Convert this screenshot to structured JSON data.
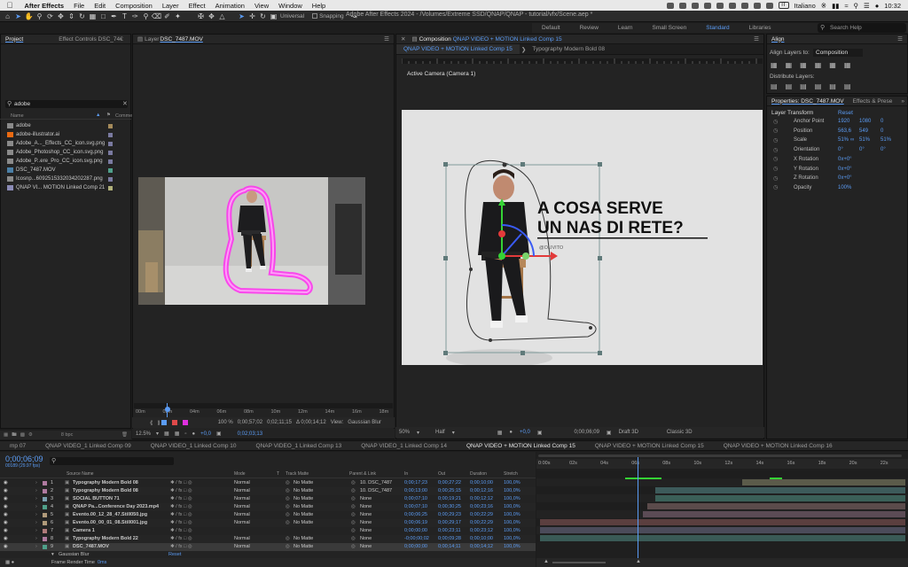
{
  "menubar": {
    "app": "After Effects",
    "items": [
      "File",
      "Edit",
      "Composition",
      "Layer",
      "Effect",
      "Animation",
      "View",
      "Window",
      "Help"
    ],
    "input_source": "IT",
    "language": "Italiano",
    "clock": "10:32"
  },
  "toolbar": {
    "title": "Adobe After Effects 2024 - /Volumes/Extreme SSD/QNAP/QNAP - tutorial/vfx/Scene.aep *",
    "universal_label": "Universal",
    "snapping_label": "Snapping"
  },
  "workspaces": {
    "items": [
      "Default",
      "Review",
      "Learn",
      "Small Screen",
      "Standard",
      "Libraries"
    ],
    "active": "Standard",
    "help_placeholder": "Search Help"
  },
  "project": {
    "tabs": [
      "Project",
      "Effect Controls DSC_74€"
    ],
    "search_value": "adobe",
    "col_name": "Name",
    "col_comment": "Comme",
    "items": [
      {
        "name": "adobe",
        "kind": "folder",
        "swatch": "#a48a5a"
      },
      {
        "name": "adobe-illustrator.ai",
        "kind": "ai",
        "swatch": "#7a7aa0"
      },
      {
        "name": "Adobe_A..._Effects_CC_icon.svg.png",
        "kind": "img",
        "swatch": "#7a7aa0"
      },
      {
        "name": "Adobe_Photoshop_CC_icon.svg.png",
        "kind": "img",
        "swatch": "#7a7aa0"
      },
      {
        "name": "Adobe_P..ere_Pro_CC_icon.svg.png",
        "kind": "img",
        "swatch": "#7a7aa0"
      },
      {
        "name": "DSC_7487.MOV",
        "kind": "vid",
        "swatch": "#4fa08a"
      },
      {
        "name": "Icosnp...6092515332034202287.png",
        "kind": "img",
        "swatch": "#7a7aa0"
      },
      {
        "name": "QNAP VI... MOTION Linked Comp 21",
        "kind": "comp",
        "swatch": "#b0b07a"
      }
    ],
    "footer_bpc": "8 bpc"
  },
  "layer_panel": {
    "tab_label": "Layer",
    "tab_name": "DSC_7487.MOV",
    "ruler_labels": [
      "00m",
      "02m",
      "04m",
      "06m",
      "08m",
      "10m",
      "12m",
      "14m",
      "16m",
      "18m"
    ],
    "zoom": "100 %",
    "time_in": "0;00;57;02",
    "time_out": "0;02;11;15",
    "duration": "Δ 0;00;14;12",
    "view_label": "View:",
    "view_value": "Gaussian Blur",
    "footer_zoom": "12.5%",
    "footer_time": "0;02;03;13",
    "exposure": "+0,0"
  },
  "composition": {
    "tab_label": "Composition",
    "tab_name": "QNAP VIDEO + MOTION Linked Comp 15",
    "subtabs": [
      "QNAP VIDEO + MOTION Linked Comp 15",
      "Typography Modern Bold 08"
    ],
    "camera_label": "Active Camera (Camera 1)",
    "headline_1": "A COSA SERVE",
    "headline_2": "UN NAS DI RETE?",
    "byline": "@OLIVITO",
    "footer_zoom": "50%",
    "footer_quality": "Half",
    "footer_exposure": "+0,0",
    "footer_time": "0;00;06;09",
    "footer_renderer": "Draft 3D",
    "footer_mode": "Classic 3D"
  },
  "align": {
    "title": "Align",
    "align_to_label": "Align Layers to:",
    "align_to_value": "Composition",
    "distribute_label": "Distribute Layers:"
  },
  "properties": {
    "tab_title": "Properties: DSC_7487.MOV",
    "tab2": "Effects & Prese",
    "section": "Layer Transform",
    "reset": "Reset",
    "rows": [
      {
        "label": "Anchor Point",
        "v1": "1920",
        "v2": "1080",
        "v3": "0"
      },
      {
        "label": "Position",
        "v1": "563,6",
        "v2": "549",
        "v3": "0"
      },
      {
        "label": "Scale",
        "v1": "51%",
        "v2": "51%",
        "v3": "51%"
      },
      {
        "label": "Orientation",
        "v1": "0°",
        "v2": "0°",
        "v3": "0°"
      },
      {
        "label": "X Rotation",
        "v1": "0x+0°",
        "v2": "",
        "v3": ""
      },
      {
        "label": "Y Rotation",
        "v1": "0x+0°",
        "v2": "",
        "v3": ""
      },
      {
        "label": "Z Rotation",
        "v1": "0x+0°",
        "v2": "",
        "v3": ""
      },
      {
        "label": "Opacity",
        "v1": "100%",
        "v2": "",
        "v3": ""
      }
    ]
  },
  "timeline": {
    "tabs": [
      {
        "label": "mp 07",
        "active": false
      },
      {
        "label": "QNAP VIDEO_1 Linked Comp 09",
        "active": false
      },
      {
        "label": "QNAP VIDEO_1 Linked Comp 10",
        "active": false
      },
      {
        "label": "QNAP VIDEO_1 Linked Comp 13",
        "active": false
      },
      {
        "label": "QNAP VIDEO_1 Linked Comp 14",
        "active": false
      },
      {
        "label": "QNAP VIDEO + MOTION Linked Comp 15",
        "active": true
      },
      {
        "label": "QNAP VIDEO + MOTION Linked Comp 15",
        "active": false
      },
      {
        "label": "QNAP VIDEO + MOTION Linked Comp 16",
        "active": false
      }
    ],
    "current_time": "0;00;06;09",
    "current_frames": "00189 (29.97 fps)",
    "headers": {
      "source": "Source Name",
      "mode": "Mode",
      "t": "T",
      "track_matte": "Track Matte",
      "parent": "Parent & Link",
      "in": "In",
      "out": "Out",
      "duration": "Duration",
      "stretch": "Stretch"
    },
    "ruler": [
      "0:00s",
      "02s",
      "04s",
      "06s",
      "08s",
      "10s",
      "12s",
      "14s",
      "16s",
      "18s",
      "20s",
      "22s"
    ],
    "playhead_s": 6.3,
    "ruler_max_s": 23.5,
    "layers": [
      {
        "n": "1",
        "name": "Typography Modern Bold 08",
        "color": "#b07aa0",
        "mode": "Normal",
        "matte": "No Matte",
        "parent": "10. DSC_7487",
        "in": "0;00;17;23",
        "out": "0;00;27;22",
        "dur": "0;00;10;00",
        "stretch": "100,0%",
        "bar": [
          0,
          0,
          "#4b4b5a"
        ]
      },
      {
        "n": "2",
        "name": "Typography Modern Bold 08",
        "color": "#b07aa0",
        "mode": "Normal",
        "matte": "No Matte",
        "parent": "10. DSC_7487",
        "in": "0;00;13;00",
        "out": "0;00;25;15",
        "dur": "0;00;12;16",
        "stretch": "100,0%",
        "bar": [
          13,
          23.5,
          "#5b5b4a"
        ]
      },
      {
        "n": "3",
        "name": "SOCIAL BUTTON 71",
        "color": "#7aa0b0",
        "mode": "Normal",
        "matte": "No Matte",
        "parent": "None",
        "in": "0;00;07;10",
        "out": "0;00;19;21",
        "dur": "0;00;12;12",
        "stretch": "100,0%",
        "bar": [
          7.4,
          23.5,
          "#3d5b5b"
        ]
      },
      {
        "n": "4",
        "name": "QNAP Pa...Conference Day 2023.mp4",
        "color": "#4fa08a",
        "mode": "Normal",
        "matte": "No Matte",
        "parent": "None",
        "in": "0;00;07;10",
        "out": "0;00;30;25",
        "dur": "0;00;23;16",
        "stretch": "100,0%",
        "bar": [
          7.4,
          23.5,
          "#3b6058"
        ]
      },
      {
        "n": "5",
        "name": "Evento.00_12_28_47.Still050.jpg",
        "color": "#b09a7a",
        "mode": "Normal",
        "matte": "No Matte",
        "parent": "None",
        "in": "0;00;06;25",
        "out": "0;00;29;23",
        "dur": "0;00;22;29",
        "stretch": "100,0%",
        "bar": [
          6.9,
          23.5,
          "#5b4b4b"
        ]
      },
      {
        "n": "6",
        "name": "Evento.00_00_01_08.Still001.jpg",
        "color": "#b09a7a",
        "mode": "Normal",
        "matte": "No Matte",
        "parent": "None",
        "in": "0;00;06;19",
        "out": "0;00;29;17",
        "dur": "0;00;22;29",
        "stretch": "100,0%",
        "bar": [
          6.6,
          23.5,
          "#5b4b55"
        ]
      },
      {
        "n": "7",
        "name": "Camera 1",
        "color": "#b07a7a",
        "mode": "",
        "matte": "",
        "parent": "None",
        "in": "0;00;00;00",
        "out": "0;00;23;11",
        "dur": "0;00;23;12",
        "stretch": "100,0%",
        "bar": [
          0,
          23.5,
          "#5b3f3f"
        ]
      },
      {
        "n": "8",
        "name": "Typography Modern Bold 22",
        "color": "#b07aa0",
        "mode": "Normal",
        "matte": "No Matte",
        "parent": "None",
        "in": "-0;00;00;02",
        "out": "0;00;09;28",
        "dur": "0;00;10;00",
        "stretch": "100,0%",
        "bar": [
          0,
          23.5,
          "#4b4b5a"
        ]
      },
      {
        "n": "9",
        "name": "DSC_7487.MOV",
        "color": "#4fa08a",
        "mode": "Normal",
        "matte": "No Matte",
        "parent": "None",
        "in": "0;00;00;00",
        "out": "0;00;14;11",
        "dur": "0;00;14;12",
        "stretch": "100,0%",
        "bar": [
          0,
          23.5,
          "#3a5a56"
        ]
      }
    ],
    "effect_row": "Gaussian Blur",
    "effect_reset": "Reset",
    "footer_label": "Frame Render Time",
    "footer_value": "0ms"
  },
  "colors": {
    "accent": "#5b9cf5",
    "magenta": "#ff2ff0",
    "panel": "#232323"
  }
}
